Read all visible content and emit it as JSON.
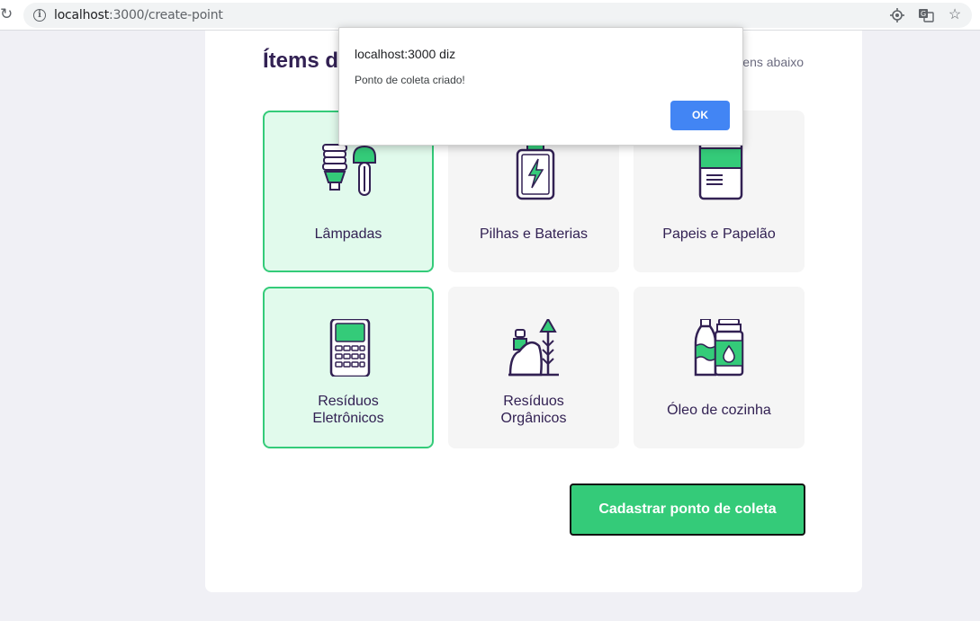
{
  "browser": {
    "url_host": "localhost",
    "url_path": ":3000/create-point"
  },
  "form": {
    "items_title": "Ítems d",
    "items_hint": "itens abaixo",
    "items": [
      {
        "label": "Lâmpadas",
        "selected": true,
        "icon": "lamp-icon"
      },
      {
        "label": "Pilhas e Baterias",
        "selected": false,
        "icon": "battery-icon"
      },
      {
        "label": "Papeis e Papelão",
        "selected": false,
        "icon": "paper-icon"
      },
      {
        "label_line1": "Resíduos",
        "label_line2": "Eletrônicos",
        "selected": true,
        "icon": "electronics-icon"
      },
      {
        "label_line1": "Resíduos",
        "label_line2": "Orgânicos",
        "selected": false,
        "icon": "organic-icon"
      },
      {
        "label": "Óleo de cozinha",
        "selected": false,
        "icon": "oil-icon"
      }
    ],
    "submit_label": "Cadastrar ponto de coleta"
  },
  "dialog": {
    "title": "localhost:3000 diz",
    "message": "Ponto de coleta criado!",
    "ok_label": "OK"
  },
  "colors": {
    "primary": "#34cb79",
    "title": "#322153",
    "selected_bg": "#e1faec",
    "dialog_button": "#4285f4"
  }
}
